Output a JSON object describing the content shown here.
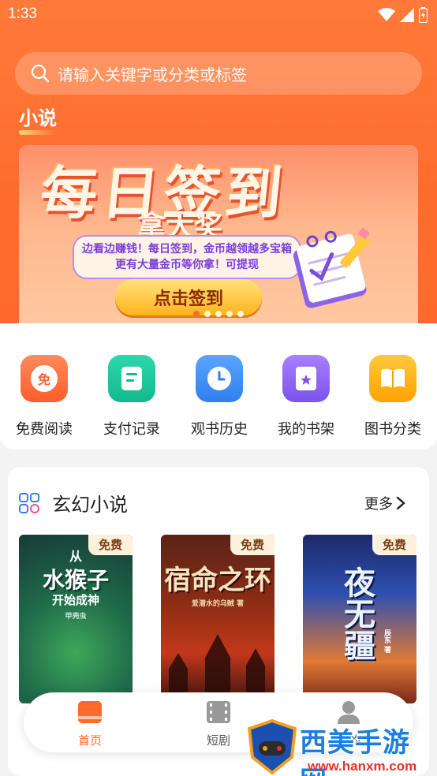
{
  "status_bar": {
    "time": "1:33"
  },
  "search": {
    "placeholder": "请输入关键字或分类或标签"
  },
  "section_tab": "小说",
  "banner": {
    "title": "每日签到",
    "subtitle": "拿大奖",
    "description": "边看边赚钱！每日签到，金币越领越多宝箱更有大量金币等你拿！可提现",
    "cta": "点击签到",
    "pages": 5,
    "active_page": 1
  },
  "quick_menu": [
    {
      "label": "免费阅读",
      "icon": "free-read-icon",
      "color": "#ff6a3a",
      "glyph": "免"
    },
    {
      "label": "支付记录",
      "icon": "payment-record-icon",
      "color": "#19c59a",
      "glyph": ""
    },
    {
      "label": "观书历史",
      "icon": "history-clock-icon",
      "color": "#3c8ff5",
      "glyph": ""
    },
    {
      "label": "我的书架",
      "icon": "bookshelf-icon",
      "color": "#8f63f0",
      "glyph": ""
    },
    {
      "label": "图书分类",
      "icon": "category-book-icon",
      "color": "#ffb11a",
      "glyph": ""
    }
  ],
  "section": {
    "title": "玄幻小说",
    "more": "更多",
    "books": [
      {
        "tag": "免费",
        "cover_lines": [
          "从",
          "水猴子",
          "开始成神"
        ],
        "cover_note": "甲壳虫"
      },
      {
        "tag": "免费",
        "cover_lines": [
          "宿命之环"
        ],
        "cover_note": "爱潜水的乌贼 著"
      },
      {
        "tag": "免费",
        "cover_lines": [
          "夜无疆"
        ],
        "cover_note": "辰东 著"
      }
    ]
  },
  "tab_bar": [
    {
      "label": "首页",
      "active": true,
      "color": "#ff6a2c"
    },
    {
      "label": "短剧",
      "active": false,
      "color": "#555555"
    },
    {
      "label": "我的",
      "active": false,
      "color": "#555555"
    }
  ],
  "watermark": {
    "text": "西美手游网",
    "url": "www.hanxm.com"
  }
}
